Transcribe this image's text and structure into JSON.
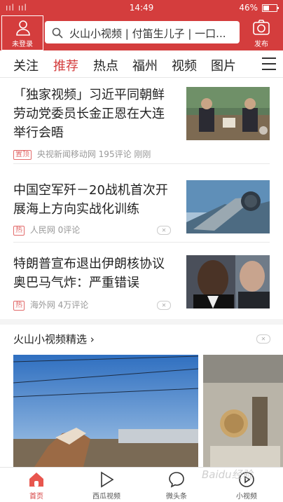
{
  "status_bar": {
    "signal": "ııl ııl",
    "time": "14:49",
    "battery": "46%"
  },
  "header": {
    "login_label": "未登录",
    "search_placeholder": "火山小视频 | 付笛生儿子 | 一口...",
    "publish_label": "发布"
  },
  "tabs": [
    "关注",
    "推荐",
    "热点",
    "福州",
    "视频",
    "图片"
  ],
  "active_tab": "推荐",
  "news": [
    {
      "title": "「独家视频」习近平同朝鲜劳动党委员长金正恩在大连举行会晤",
      "badge": "置顶",
      "source": "央视新闻移动网",
      "comments": "195评论",
      "time": "刚刚"
    },
    {
      "title": "中国空军歼－20战机首次开展海上方向实战化训练",
      "badge": "热",
      "source": "人民网",
      "comments": "0评论"
    },
    {
      "title": "特朗普宣布退出伊朗核协议 奥巴马气炸：严重错误",
      "badge": "热",
      "source": "海外网",
      "comments": "4万评论"
    }
  ],
  "section": {
    "title": "火山小视频精选 ›"
  },
  "bottom_nav": [
    {
      "label": "首页",
      "icon": "home-icon"
    },
    {
      "label": "西瓜视频",
      "icon": "play-icon"
    },
    {
      "label": "微头条",
      "icon": "chat-bubble-icon"
    },
    {
      "label": "小视频",
      "icon": "small-video-icon"
    }
  ],
  "watermark": "Baidu经验",
  "colors": {
    "accent": "#d43d3d"
  }
}
